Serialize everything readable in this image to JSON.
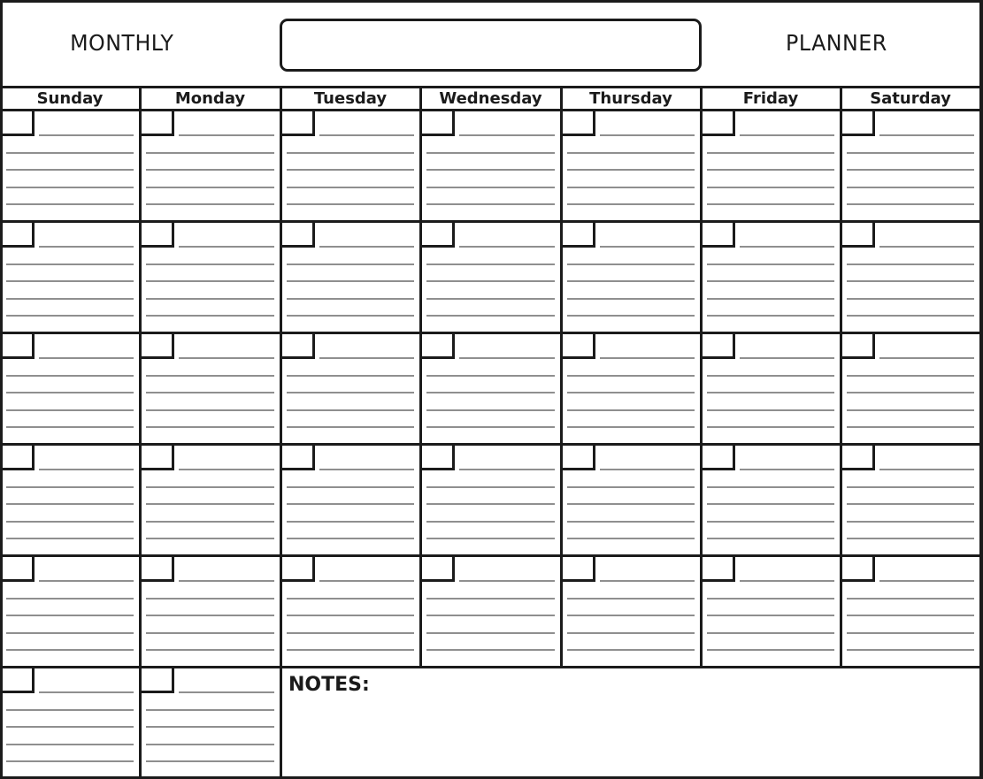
{
  "header": {
    "left_title": "MONTHLY",
    "right_title": "PLANNER",
    "month_field_value": ""
  },
  "days": [
    "Sunday",
    "Monday",
    "Tuesday",
    "Wednesday",
    "Thursday",
    "Friday",
    "Saturday"
  ],
  "grid": {
    "weeks": 6,
    "lines_per_cell": 5,
    "last_week_day_cells": 2
  },
  "notes": {
    "label": "NOTES:",
    "value": ""
  },
  "colors": {
    "border": "#1b1b1b",
    "rule": "#8f8f8f",
    "background": "#ffffff"
  }
}
